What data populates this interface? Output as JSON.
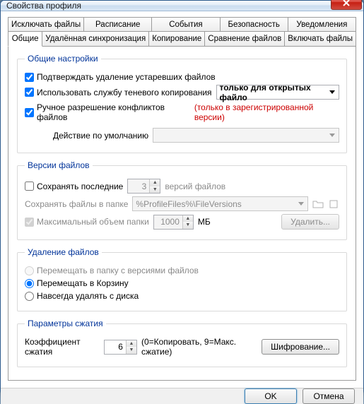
{
  "window": {
    "title": "Свойства профиля"
  },
  "tabs_row1": [
    {
      "label": "Исключать файлы"
    },
    {
      "label": "Расписание"
    },
    {
      "label": "События"
    },
    {
      "label": "Безопасность"
    },
    {
      "label": "Уведомления"
    }
  ],
  "tabs_row2": [
    {
      "label": "Общие",
      "active": true
    },
    {
      "label": "Удалённая синхронизация"
    },
    {
      "label": "Копирование"
    },
    {
      "label": "Сравнение файлов"
    },
    {
      "label": "Включать файлы"
    }
  ],
  "general": {
    "legend": "Общие настройки",
    "confirm_delete": "Подтверждать удаление устаревших файлов",
    "use_shadow": "Использовать службу теневого копирования",
    "shadow_mode": "только для открытых файло",
    "manual_conflict": "Ручное разрешение конфликтов файлов",
    "registered_only": "(только в зарегистрированной версии)",
    "default_action_label": "Действие по умолчанию",
    "default_action_value": ""
  },
  "versions": {
    "legend": "Версии файлов",
    "keep_last": "Сохранять последние",
    "keep_last_value": "3",
    "keep_last_suffix": "версий файлов",
    "save_in_folder": "Сохранять файлы в папке",
    "folder_value": "%ProfileFiles%\\FileVersions",
    "max_size": "Максимальный объем папки",
    "max_size_value": "1000",
    "max_size_unit": "МБ",
    "delete_btn": "Удалить..."
  },
  "deletion": {
    "legend": "Удаление файлов",
    "to_versions": "Перемещать в папку с версиями файлов",
    "to_recycle": "Перемещать в Корзину",
    "permanent": "Навсегда удалять с диска"
  },
  "compress": {
    "legend": "Параметры сжатия",
    "ratio_label": "Коэффициент сжатия",
    "ratio_value": "6",
    "ratio_note": "(0=Копировать, 9=Макс. сжатие)",
    "encrypt_btn": "Шифрование..."
  },
  "footer": {
    "ok": "OK",
    "cancel": "Отмена"
  }
}
